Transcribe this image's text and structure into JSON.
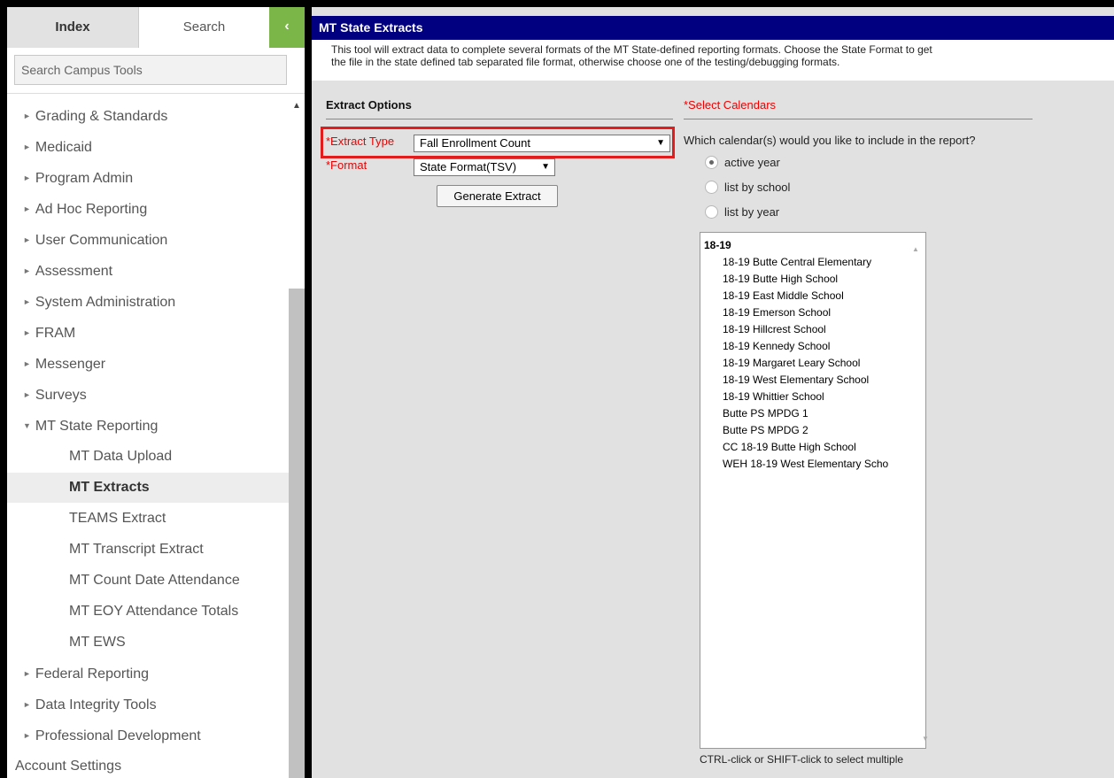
{
  "sidebar": {
    "tabs": {
      "index": "Index",
      "search": "Search",
      "collapse_glyph": "‹"
    },
    "search_placeholder": "Search Campus Tools",
    "scroll_up_glyph": "▲",
    "arrow_collapsed": "►",
    "arrow_expanded": "▼",
    "items": [
      {
        "label": "Grading & Standards"
      },
      {
        "label": "Medicaid"
      },
      {
        "label": "Program Admin"
      },
      {
        "label": "Ad Hoc Reporting"
      },
      {
        "label": "User Communication"
      },
      {
        "label": "Assessment"
      },
      {
        "label": "System Administration"
      },
      {
        "label": "FRAM"
      },
      {
        "label": "Messenger"
      },
      {
        "label": "Surveys"
      },
      {
        "label": "MT State Reporting"
      },
      {
        "label": "MT Data Upload"
      },
      {
        "label": "MT Extracts"
      },
      {
        "label": "TEAMS Extract"
      },
      {
        "label": "MT Transcript Extract"
      },
      {
        "label": "MT Count Date Attendance"
      },
      {
        "label": "MT EOY Attendance Totals"
      },
      {
        "label": "MT EWS"
      },
      {
        "label": "Federal Reporting"
      },
      {
        "label": "Data Integrity Tools"
      },
      {
        "label": "Professional Development"
      },
      {
        "label": "Account Settings"
      }
    ]
  },
  "main": {
    "title": "MT State Extracts",
    "description_line1": "This tool will extract data to complete several formats of the MT State-defined reporting formats. Choose the State Format to get",
    "description_line2": "the file in the state defined tab separated file format, otherwise choose one of the testing/debugging formats.",
    "extract_options_header": "Extract Options",
    "extract_type_label": "*Extract Type",
    "extract_type_value": "Fall Enrollment Count",
    "format_label": "*Format",
    "format_value": "State Format(TSV)",
    "select_caret": "▼",
    "generate_button": "Generate Extract",
    "calendars_header": "*Select Calendars",
    "calendar_question": "Which calendar(s) would you like to include in the report?",
    "radio_options": [
      {
        "label": "active year",
        "checked": true
      },
      {
        "label": "list by school",
        "checked": false
      },
      {
        "label": "list by year",
        "checked": false
      }
    ],
    "calendar_items": [
      {
        "label": "18-19"
      },
      {
        "label": "18-19 Butte Central Elementary"
      },
      {
        "label": "18-19 Butte High School"
      },
      {
        "label": "18-19 East Middle School"
      },
      {
        "label": "18-19 Emerson School"
      },
      {
        "label": "18-19 Hillcrest School"
      },
      {
        "label": "18-19 Kennedy School"
      },
      {
        "label": "18-19 Margaret Leary School"
      },
      {
        "label": "18-19 West Elementary School"
      },
      {
        "label": "18-19 Whittier School"
      },
      {
        "label": "Butte PS MPDG 1"
      },
      {
        "label": "Butte PS MPDG 2"
      },
      {
        "label": "CC 18-19 Butte High School"
      },
      {
        "label": "WEH 18-19 West Elementary Scho"
      }
    ],
    "list_scroll_up_glyph": "▲",
    "list_scroll_down_glyph": "▼",
    "list_hint": "CTRL-click or SHIFT-click to select multiple"
  }
}
